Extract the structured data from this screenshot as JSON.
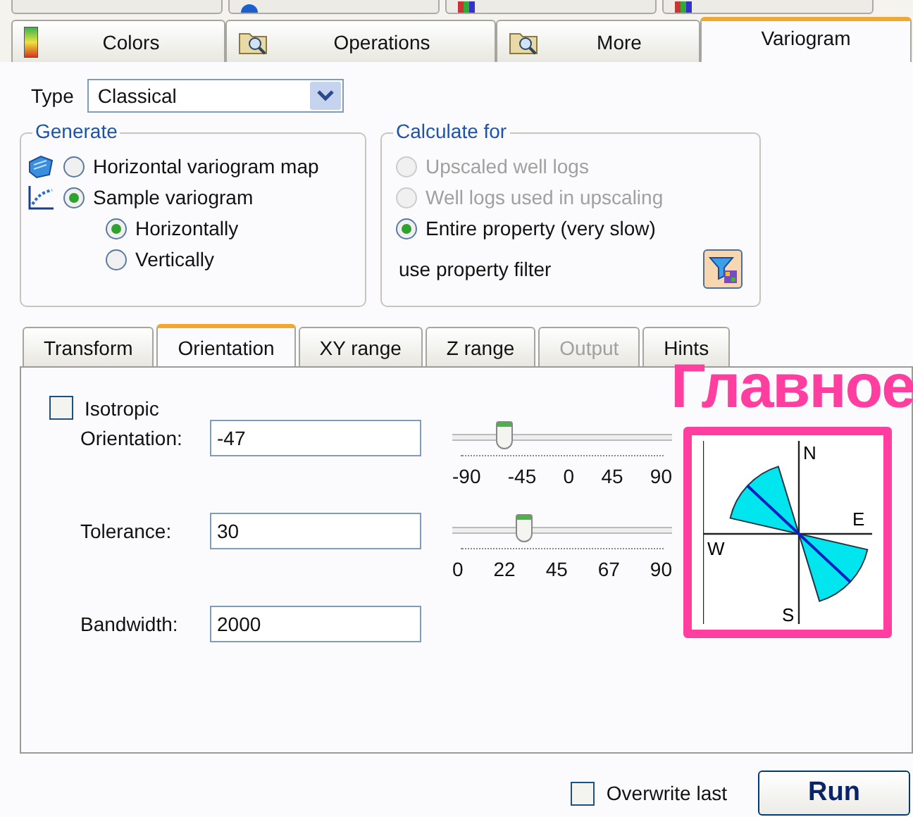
{
  "top_tabs": [
    {
      "label": "Colors",
      "selected": false,
      "kind": "gradient"
    },
    {
      "label": "Operations",
      "selected": false,
      "kind": "folder"
    },
    {
      "label": "More",
      "selected": false,
      "kind": "folder"
    },
    {
      "label": "Variogram",
      "selected": true,
      "kind": "plain"
    }
  ],
  "type_field": {
    "label": "Type",
    "value": "Classical"
  },
  "generate": {
    "title": "Generate",
    "options": [
      {
        "label": "Horizontal variogram map",
        "selected": false,
        "kind": "map"
      },
      {
        "label": "Sample variogram",
        "selected": true,
        "kind": "chart",
        "children": [
          {
            "label": "Horizontally",
            "selected": true
          },
          {
            "label": "Vertically",
            "selected": false
          }
        ]
      }
    ]
  },
  "calculate_for": {
    "title": "Calculate for",
    "options": [
      {
        "label": "Upscaled well logs",
        "selected": false,
        "disabled": true
      },
      {
        "label": "Well logs used in upscaling",
        "selected": false,
        "disabled": true
      },
      {
        "label": "Entire property (very slow)",
        "selected": true,
        "disabled": false
      }
    ],
    "filter_label": "use property filter"
  },
  "sub_tabs": [
    {
      "label": "Transform",
      "selected": false,
      "disabled": false
    },
    {
      "label": "Orientation",
      "selected": true,
      "disabled": false
    },
    {
      "label": "XY range",
      "selected": false,
      "disabled": false
    },
    {
      "label": "Z range",
      "selected": false,
      "disabled": false
    },
    {
      "label": "Output",
      "selected": false,
      "disabled": true
    },
    {
      "label": "Hints",
      "selected": false,
      "disabled": false
    }
  ],
  "isotropic": {
    "label": "Isotropic",
    "checked": false
  },
  "parameters": [
    {
      "label": "Orientation:",
      "value": "-47",
      "slider": {
        "level": 0.24,
        "ticks": [
          "-90",
          "-45",
          "0",
          "45",
          "90"
        ]
      }
    },
    {
      "label": "Tolerance:",
      "value": "30",
      "slider": {
        "level": 0.33,
        "ticks": [
          "0",
          "22",
          "45",
          "67",
          "90"
        ]
      }
    },
    {
      "label": "Bandwidth:",
      "value": "2000"
    }
  ],
  "compass": {
    "north": "N",
    "west": "W",
    "east": "E",
    "south": "S"
  },
  "annotation": "Главное",
  "overwrite_last": {
    "label": "Overwrite last",
    "checked": false
  },
  "run_button": "Run"
}
